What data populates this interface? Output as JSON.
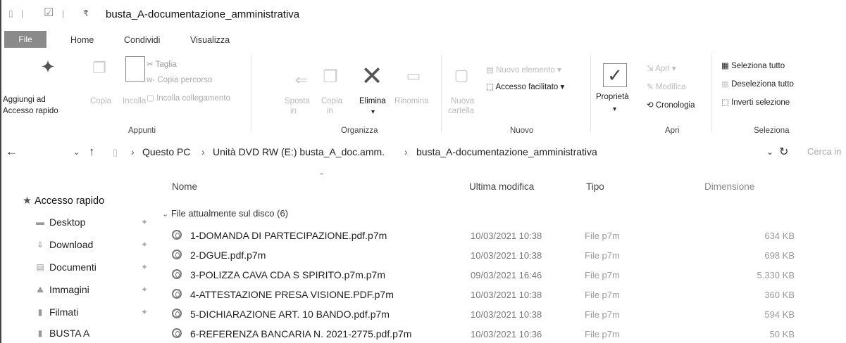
{
  "window": {
    "title": "busta_A-documentazione_amministrativa"
  },
  "tabs": [
    "File",
    "Home",
    "Condividi",
    "Visualizza"
  ],
  "ribbon": {
    "appunti": {
      "pin_label_1": "Aggiungi ad",
      "pin_label_2": "Accesso rapido",
      "copia": "Copia",
      "incolla": "Incolla",
      "taglia": "Taglia",
      "copia_percorso": "Copia percorso",
      "incolla_collegamento": "Incolla collegamento",
      "group": "Appunti"
    },
    "organizza": {
      "sposta_1": "Sposta",
      "sposta_2": "in",
      "copia_1": "Copia",
      "copia_2": "in",
      "elimina": "Elimina",
      "rinomina": "Rinomina",
      "group": "Organizza"
    },
    "nuovo": {
      "nuova_cartella_1": "Nuova",
      "nuova_cartella_2": "cartella",
      "nuovo_elemento": "Nuovo elemento",
      "accesso_facilitato": "Accesso facilitato",
      "group": "Nuovo"
    },
    "apri": {
      "proprieta": "Proprietà",
      "apri": "Apri",
      "modifica": "Modifica",
      "cronologia": "Cronologia",
      "group": "Apri"
    },
    "seleziona": {
      "seleziona_tutto": "Seleziona tutto",
      "deseleziona_tutto": "Deseleziona tutto",
      "inverti_selezione": "Inverti selezione",
      "group": "Seleziona"
    }
  },
  "address": {
    "crumbs": [
      "Questo PC",
      "Unità DVD RW (E:) busta_A_doc.amm.",
      "busta_A-documentazione_amministrativa"
    ],
    "search_placeholder": "Cerca in"
  },
  "columns": {
    "name": "Nome",
    "modified": "Ultima modifica",
    "type": "Tipo",
    "size": "Dimensione"
  },
  "sidebar": {
    "quick_access": "Accesso rapido",
    "items": [
      {
        "label": "Desktop",
        "pinned": true
      },
      {
        "label": "Download",
        "pinned": true
      },
      {
        "label": "Documenti",
        "pinned": true
      },
      {
        "label": "Immagini",
        "pinned": true
      },
      {
        "label": "Filmati",
        "pinned": true
      },
      {
        "label": "BUSTA A",
        "pinned": false
      }
    ]
  },
  "group_header": "File attualmente sul disco (6)",
  "files": [
    {
      "name": "1-DOMANDA DI PARTECIPAZIONE.pdf.p7m",
      "modified": "10/03/2021 10:38",
      "type": "File p7m",
      "size": "634 KB"
    },
    {
      "name": "2-DGUE.pdf.p7m",
      "modified": "10/03/2021 10:38",
      "type": "File p7m",
      "size": "698 KB"
    },
    {
      "name": "3-POLIZZA CAVA CDA S SPIRITO.p7m.p7m",
      "modified": "09/03/2021 16:46",
      "type": "File p7m",
      "size": "5.330 KB"
    },
    {
      "name": "4-ATTESTAZIONE PRESA VISIONE.PDF.p7m",
      "modified": "10/03/2021 10:38",
      "type": "File p7m",
      "size": "360 KB"
    },
    {
      "name": "5-DICHIARAZIONE ART. 10 BANDO.pdf.p7m",
      "modified": "10/03/2021 10:38",
      "type": "File p7m",
      "size": "594 KB"
    },
    {
      "name": "6-REFERENZA BANCARIA N. 2021-2775.pdf.p7m",
      "modified": "10/03/2021 10:36",
      "type": "File p7m",
      "size": "50 KB"
    }
  ]
}
